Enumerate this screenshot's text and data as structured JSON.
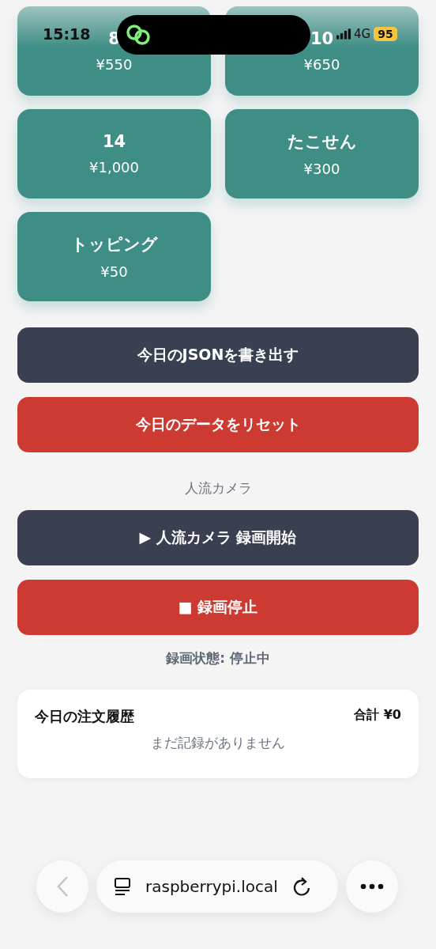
{
  "status_bar": {
    "time": "15:18",
    "network": "4G",
    "battery": "95"
  },
  "products": [
    {
      "name": "8",
      "price": "¥550"
    },
    {
      "name": "10",
      "price": "¥650"
    },
    {
      "name": "14",
      "price": "¥1,000"
    },
    {
      "name": "たこせん",
      "price": "¥300"
    },
    {
      "name": "トッピング",
      "price": "¥50"
    }
  ],
  "actions": [
    {
      "label": "今日のJSONを書き出す",
      "kind": "dark"
    },
    {
      "label": "今日のデータをリセット",
      "kind": "danger"
    }
  ],
  "camera": {
    "title": "人流カメラ",
    "buttons": [
      {
        "label": "▶ 人流カメラ 録画開始",
        "kind": "dark"
      },
      {
        "label": "■ 録画停止",
        "kind": "danger"
      }
    ],
    "status": "録画状態: 停止中"
  },
  "history": {
    "title": "今日の注文履歴",
    "total": "合計 ¥0",
    "empty": "まだ記録がありません"
  },
  "browser": {
    "url": "raspberrypi.local",
    "back_disabled": true
  }
}
